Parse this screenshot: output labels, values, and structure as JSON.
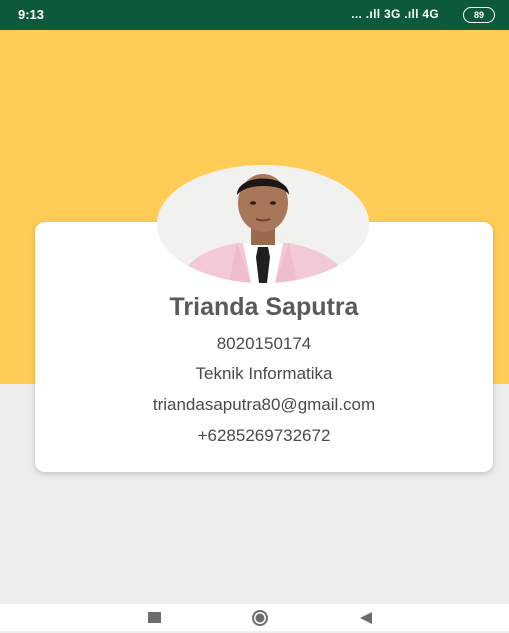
{
  "status_bar": {
    "time": "9:13",
    "signal": "... .ıll 3G .ıll 4G",
    "battery": "89"
  },
  "profile": {
    "name": "Trianda Saputra",
    "nim": "8020150174",
    "major": "Teknik Informatika",
    "email": "triandasaputra80@gmail.com",
    "phone": "+6285269732672"
  },
  "colors": {
    "status_bar": "#0d5a3a",
    "header": "#ffcd56",
    "background": "#ededeb",
    "card": "#ffffff"
  },
  "nav": {
    "icons": [
      "recent-apps-icon",
      "home-icon",
      "back-icon"
    ]
  }
}
